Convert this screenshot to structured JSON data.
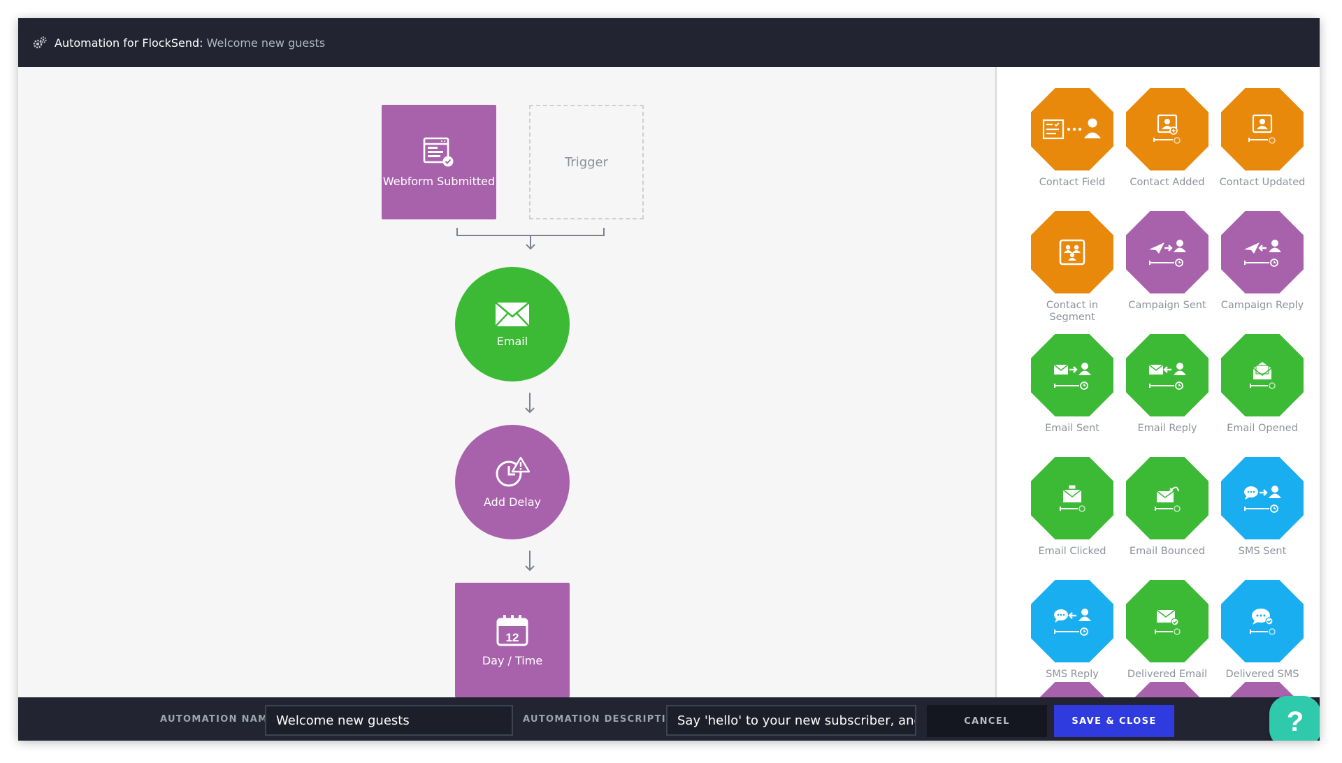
{
  "header": {
    "app_name": "Automation for FlockSend",
    "separator": ":",
    "automation_title": "Welcome new guests"
  },
  "flow": {
    "trigger_node": {
      "label": "Webform Submitted",
      "icon": "webform-icon",
      "color": "#a862ac"
    },
    "trigger_placeholder": {
      "label": "Trigger"
    },
    "email_node": {
      "label": "Email",
      "icon": "envelope-icon",
      "color": "#3cb935"
    },
    "delay_node": {
      "label": "Add Delay",
      "icon": "clock-alert-icon",
      "color": "#a862ac"
    },
    "daytime_node": {
      "label": "Day / Time",
      "icon": "calendar-icon",
      "color": "#a862ac",
      "day_number": "12"
    }
  },
  "palette": {
    "items": [
      {
        "label": "Contact Field",
        "color": "#e8890c",
        "icon": "contact-field-icon"
      },
      {
        "label": "Contact Added",
        "color": "#e8890c",
        "icon": "contact-added-icon"
      },
      {
        "label": "Contact Updated",
        "color": "#e8890c",
        "icon": "contact-updated-icon"
      },
      {
        "label": "Contact in Segment",
        "color": "#e8890c",
        "icon": "segment-icon"
      },
      {
        "label": "Campaign Sent",
        "color": "#a862ac",
        "icon": "campaign-sent-icon"
      },
      {
        "label": "Campaign Reply",
        "color": "#a862ac",
        "icon": "campaign-reply-icon"
      },
      {
        "label": "Email Sent",
        "color": "#3cb935",
        "icon": "email-sent-icon"
      },
      {
        "label": "Email Reply",
        "color": "#3cb935",
        "icon": "email-reply-icon"
      },
      {
        "label": "Email Opened",
        "color": "#3cb935",
        "icon": "email-opened-icon"
      },
      {
        "label": "Email Clicked",
        "color": "#3cb935",
        "icon": "email-clicked-icon"
      },
      {
        "label": "Email Bounced",
        "color": "#3cb935",
        "icon": "email-bounced-icon"
      },
      {
        "label": "SMS Sent",
        "color": "#19aef0",
        "icon": "sms-sent-icon"
      },
      {
        "label": "SMS Reply",
        "color": "#19aef0",
        "icon": "sms-reply-icon"
      },
      {
        "label": "Delivered Email",
        "color": "#3cb935",
        "icon": "delivered-email-icon"
      },
      {
        "label": "Delivered SMS",
        "color": "#19aef0",
        "icon": "delivered-sms-icon"
      }
    ],
    "partial_next_row_color": "#a862ac"
  },
  "footer": {
    "name_label": "AUTOMATION NAME",
    "name_value": "Welcome new guests",
    "description_label": "AUTOMATION DESCRIPTION",
    "description_value": "Say 'hello' to your new subscriber, and le",
    "cancel_label": "CANCEL",
    "save_label": "SAVE & CLOSE",
    "help_label": "?"
  },
  "colors": {
    "dark_bar": "#222531",
    "save_button": "#2f3bdf",
    "help_button": "#2fc9ab",
    "connector": "#7a8290"
  }
}
